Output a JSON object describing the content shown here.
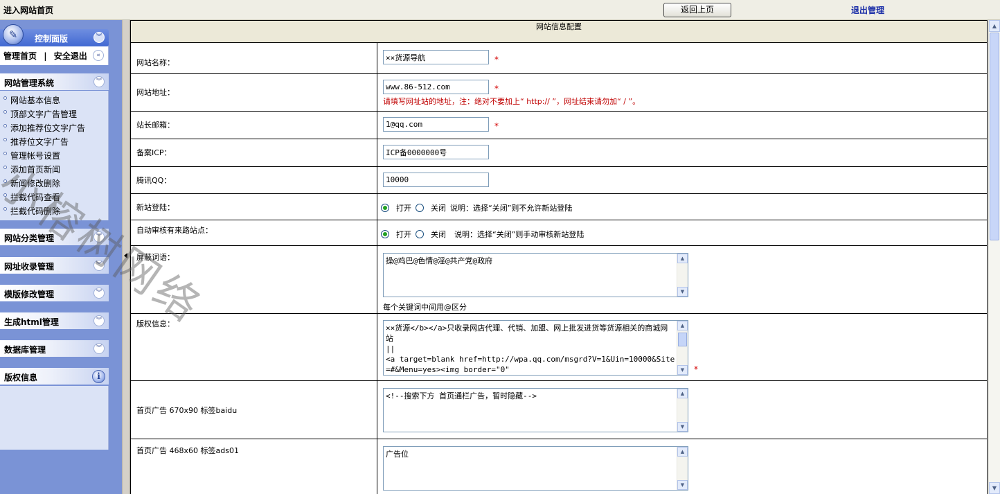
{
  "topbar": {
    "home_link": "进入网站首页",
    "back_button": "返回上页",
    "logout_link": "退出管理"
  },
  "sidebar": {
    "control_panel": {
      "title": "控制面版",
      "admin_home": "管理首页",
      "separator": "|",
      "safe_exit": "安全退出"
    },
    "site_system": {
      "title": "网站管理系统",
      "items": [
        "网站基本信息",
        "顶部文字广告管理",
        "添加推荐位文字广告",
        "推荐位文字广告",
        "管理帐号设置",
        "添加首页新闻",
        "新闻修改删除",
        "拦截代码查看",
        "拦截代码删除"
      ]
    },
    "sections": [
      "网站分类管理",
      "网址收录管理",
      "模版修改管理",
      "生成html管理",
      "数据库管理"
    ],
    "copyright": {
      "title": "版权信息"
    },
    "icons": {
      "chevron_down": "chevron-down-icon",
      "chevron_left": "chevron-left-icon",
      "info": "info-icon",
      "control_panel": "control-panel-icon"
    }
  },
  "main": {
    "header": "网站信息配置",
    "fields": {
      "site_name": {
        "label": "网站名称：",
        "value": "××货源导航",
        "required": "*"
      },
      "site_url": {
        "label": "网站地址：",
        "value": "www.86-512.com",
        "required": "*",
        "hint": "请填写网址站的地址，注：绝对不要加上“ http:// ”，网址结束请勿加“ / ”。"
      },
      "admin_email": {
        "label": "站长邮箱：",
        "value": "1@qq.com",
        "required": "*"
      },
      "icp": {
        "label": "备案ICP：",
        "value": "ICP备0000000号"
      },
      "qq": {
        "label": "腾讯QQ：",
        "value": "10000"
      },
      "new_login": {
        "label": "新站登陆：",
        "open": "打开",
        "close": "关闭",
        "note": "说明：选择“关闭”则不允许新站登陆"
      },
      "auto_review": {
        "label": "自动审核有来路站点：",
        "open": "打开",
        "close": "关闭",
        "note": "说明：选择“关闭”则手动审核新站登陆"
      },
      "blocked_words": {
        "label": "屏蔽词语：",
        "value": "操@鸡巴@色情@淫@共产党@政府",
        "hint": "每个关键词中间用@区分"
      },
      "copyright_info": {
        "label": "版权信息：",
        "value": "××货源</b></a>只收录网店代理、代销、加盟、网上批发进货等货源相关的商城网站\n||\n<a target=blank href=http://wpa.qq.com/msgrd?V=1&Uin=10000&Site=#&Menu=yes><img border=\"0\"",
        "required": "*"
      },
      "ad_banner": {
        "label": "首页广告 670x90 标签baidu",
        "value": "<!--搜索下方 首页通栏广告，暂时隐藏-->"
      },
      "ad_ads01": {
        "label": "首页广告 468x60 标签ads01",
        "value": "广告位"
      }
    }
  },
  "watermark": "小榕树网络",
  "colors": {
    "sidebar_bg": "#7a93d6",
    "panel_accent": "#4169d2",
    "required_star": "#d40000",
    "hint_red": "#c00000",
    "logout_link": "#1c2fa8"
  }
}
